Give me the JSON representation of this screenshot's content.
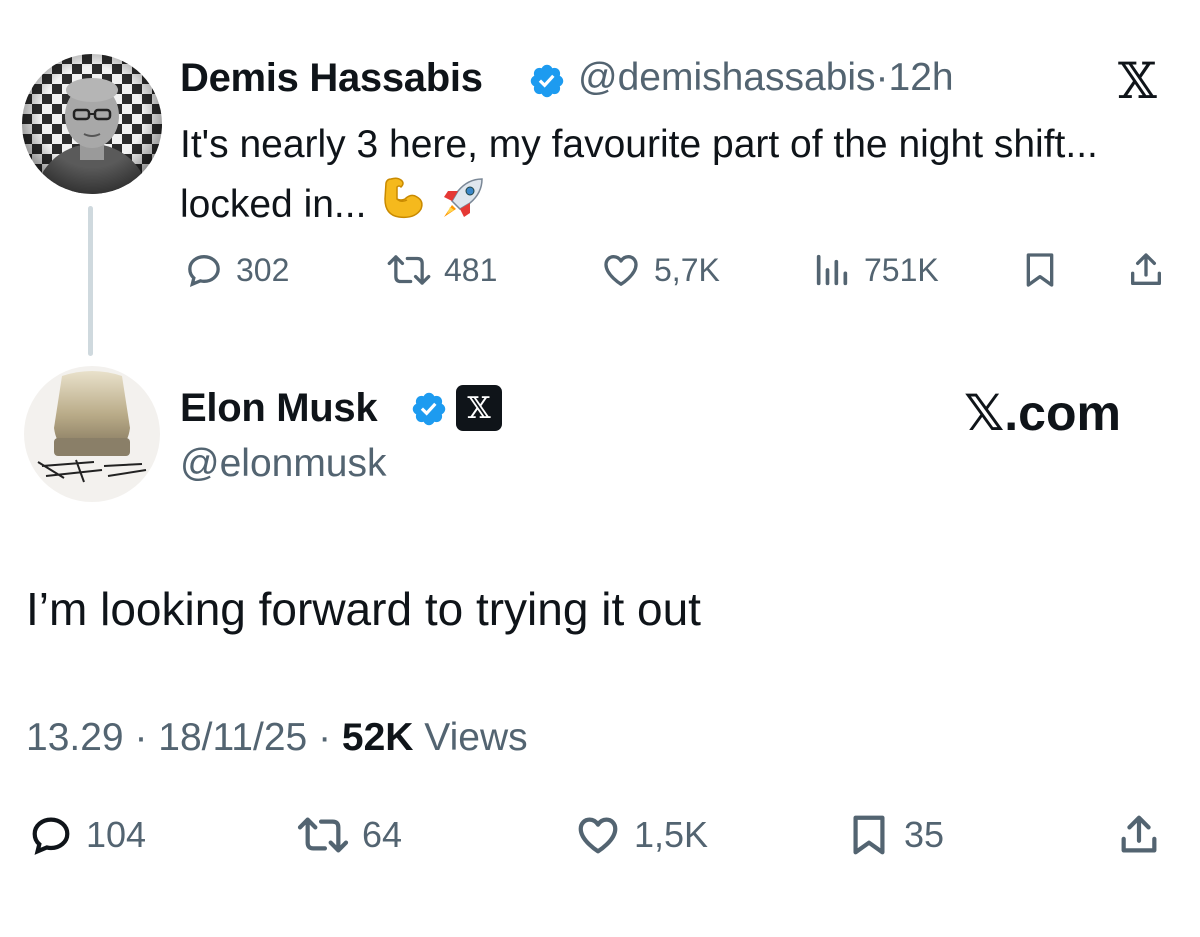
{
  "quoted_tweet": {
    "author_name": "Demis Hassabis",
    "handle": "@demishassabis",
    "separator": "·",
    "time": "12h",
    "text": "It's nearly 3 here, my favourite part of the night shift... locked in...",
    "emojis": [
      "flexed-biceps",
      "rocket"
    ],
    "stats": {
      "replies": "302",
      "reposts": "481",
      "likes": "5,7K",
      "views": "751K"
    }
  },
  "main_tweet": {
    "author_name": "Elon Musk",
    "handle": "@elonmusk",
    "affiliation_badge": "𝕏",
    "brand_link": "𝕏.com",
    "text": "I’m looking forward to trying it out",
    "time": "13.29",
    "date": "18/11/25",
    "separator": "·",
    "views_count": "52K",
    "views_label": "Views",
    "stats": {
      "replies": "104",
      "reposts": "64",
      "likes": "1,5K",
      "bookmarks": "35"
    }
  },
  "x_logo": "𝕏",
  "colors": {
    "text": "#0f1419",
    "secondary": "#536471",
    "verified_blue": "#1d9bf0",
    "thread_line": "#cfd9de"
  }
}
